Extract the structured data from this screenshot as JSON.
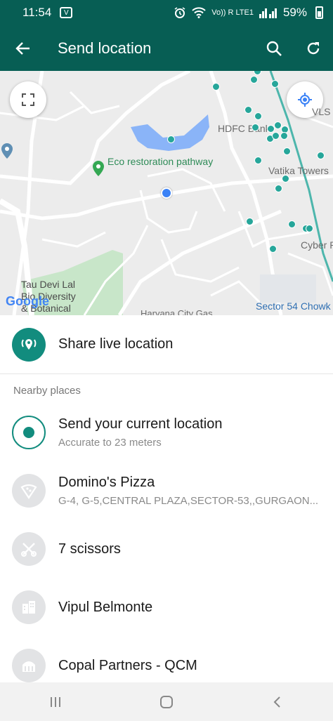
{
  "status_bar": {
    "time": "11:54",
    "app_icon": "V",
    "network_small": "Vo)) R\nLTE1",
    "battery": "59%",
    "icons": [
      "alarm-icon",
      "wifi-icon",
      "signal-icon",
      "battery-icon"
    ]
  },
  "toolbar": {
    "title": "Send location",
    "icons": [
      "back-arrow-icon",
      "search-icon",
      "refresh-icon"
    ]
  },
  "map": {
    "labels": {
      "hdfc": "HDFC Bank",
      "vls": "VLS B",
      "eco": "Eco restoration pathway",
      "vatika": "Vatika Towers",
      "cyber": "Cyber P",
      "tau1": "Tau Devi Lal",
      "tau2": "Bio Diversity",
      "tau3": "& Botanical",
      "haryana": "Haryana City Gas",
      "sector": "Sector 54 Chowk",
      "google": "Google"
    },
    "icons": [
      "fullscreen-icon",
      "my-location-icon"
    ],
    "colors": {
      "marker": "#26a69a",
      "current": "#3b82f6",
      "rail": "#4db6ac",
      "park": "#c8e6c9"
    }
  },
  "share_live": {
    "label": "Share live location"
  },
  "nearby_header": "Nearby places",
  "places": [
    {
      "title": "Send your current location",
      "subtitle": "Accurate to 23 meters",
      "icon": "current-location-icon"
    },
    {
      "title": "Domino's Pizza",
      "subtitle": "G-4, G-5,CENTRAL PLAZA,SECTOR-53,,GURGAON...",
      "icon": "pizza-icon"
    },
    {
      "title": "7 scissors",
      "subtitle": "",
      "icon": "scissors-icon"
    },
    {
      "title": "Vipul Belmonte",
      "subtitle": "",
      "icon": "building-icon"
    },
    {
      "title": "Copal Partners - QCM",
      "subtitle": "",
      "icon": "institution-icon"
    }
  ],
  "nav_bar": {
    "icons": [
      "recents-icon",
      "home-icon",
      "back-icon"
    ]
  },
  "colors": {
    "primary": "#075e54",
    "accent": "#128c7e"
  }
}
